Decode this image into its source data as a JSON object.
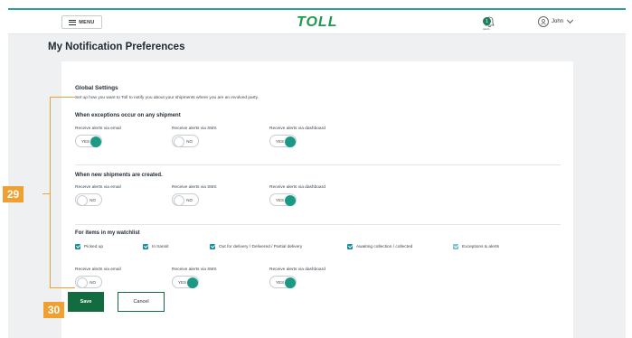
{
  "header": {
    "menu_label": "MENU",
    "logo_text": "TOLL",
    "notification_count": "1",
    "notification_label": "Alerts",
    "user_name": "John"
  },
  "page": {
    "title": "My Notification Preferences"
  },
  "global": {
    "title": "Global Settings",
    "subtitle": "Set up how you want to Toll to notify you about your shipments where you are an involved party."
  },
  "sections": [
    {
      "title": "When exceptions occur on any shipment",
      "toggles": [
        {
          "label": "Receive alerts via email",
          "state": "YES",
          "on": true
        },
        {
          "label": "Receive alerts via SMS",
          "state": "NO",
          "on": false
        },
        {
          "label": "Receive alerts via dashboard",
          "state": "YES",
          "on": true
        }
      ]
    },
    {
      "title": "When new shipments are created.",
      "toggles": [
        {
          "label": "Receive alerts via email",
          "state": "NO",
          "on": false
        },
        {
          "label": "Receive alerts via SMS",
          "state": "NO",
          "on": false
        },
        {
          "label": "Receive alerts via dashboard",
          "state": "YES",
          "on": true
        }
      ]
    },
    {
      "title": "For items in my watchlist",
      "checkboxes": [
        {
          "label": "Picked up",
          "checked": true
        },
        {
          "label": "In transit",
          "checked": true
        },
        {
          "label": "Out for delivery / Delivered / Partial delivery",
          "checked": true
        },
        {
          "label": "Awaiting collection / collected",
          "checked": true
        },
        {
          "label": "Exceptions & alerts",
          "checked": true
        }
      ],
      "toggles": [
        {
          "label": "Receive alerts via email",
          "state": "NO",
          "on": false
        },
        {
          "label": "Receive alerts via SMS",
          "state": "YES",
          "on": true
        },
        {
          "label": "Receive alerts via dashboard",
          "state": "YES",
          "on": true
        }
      ]
    }
  ],
  "actions": {
    "save_label": "Save",
    "cancel_label": "Cancel"
  },
  "annotations": {
    "badge_a": "29",
    "badge_b": "30"
  },
  "colors": {
    "brand_green": "#1d9a4c",
    "save_green": "#136b40",
    "toggle_on": "#1a9a85",
    "checkbox": "#1a8ea0",
    "annotation_orange": "#f0a030"
  }
}
